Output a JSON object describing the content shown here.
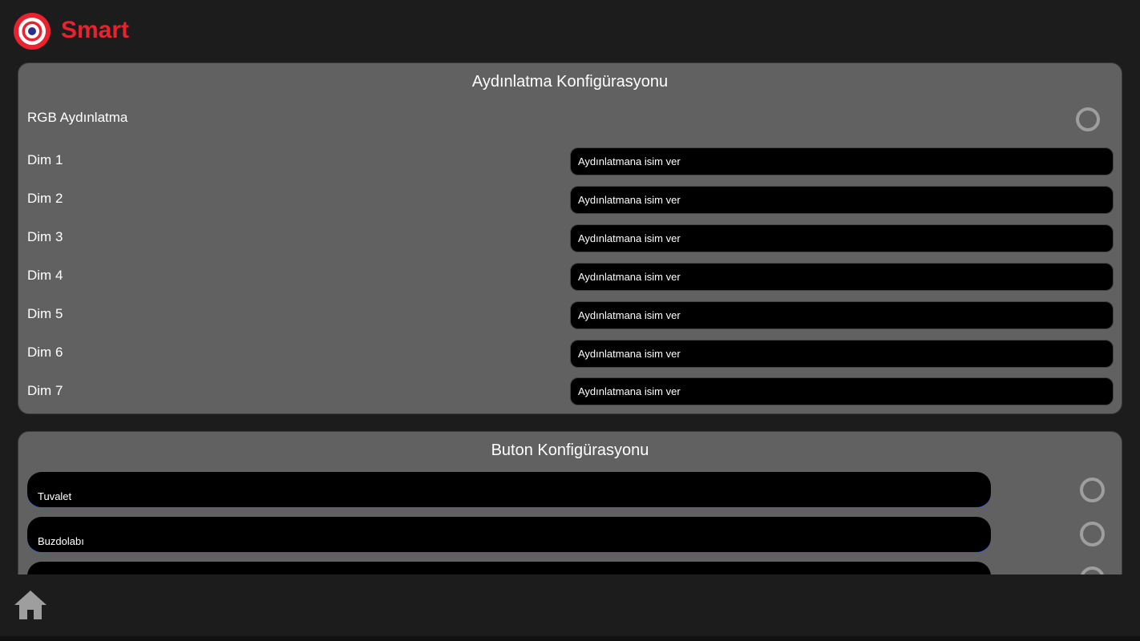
{
  "header": {
    "app_name": "Smart",
    "logo_icon": "target-icon",
    "brand_color": "#e8232f"
  },
  "lighting": {
    "title": "Aydınlatma Konfigürasyonu",
    "rgb_label": "RGB Aydınlatma",
    "rgb_selected": false,
    "dims": [
      {
        "label": "Dim 1",
        "placeholder": "Aydınlatmana isim ver"
      },
      {
        "label": "Dim 2",
        "placeholder": "Aydınlatmana isim ver"
      },
      {
        "label": "Dim 3",
        "placeholder": "Aydınlatmana isim ver"
      },
      {
        "label": "Dim 4",
        "placeholder": "Aydınlatmana isim ver"
      },
      {
        "label": "Dim 5",
        "placeholder": "Aydınlatmana isim ver"
      },
      {
        "label": "Dim 6",
        "placeholder": "Aydınlatmana isim ver"
      },
      {
        "label": "Dim 7",
        "placeholder": "Aydınlatmana isim ver"
      }
    ]
  },
  "buttons": {
    "title": "Buton Konfigürasyonu",
    "items": [
      {
        "value": "Tuvalet",
        "selected": false
      },
      {
        "value": "Buzdolabı",
        "selected": false
      },
      {
        "value": "",
        "selected": false
      }
    ]
  },
  "bottom_nav": {
    "home_icon": "home-icon"
  },
  "colors": {
    "background": "#1c1c1c",
    "card": "#616161",
    "input": "#000000",
    "radio": "#9e9e9e",
    "underline": "#3a5bd9"
  }
}
